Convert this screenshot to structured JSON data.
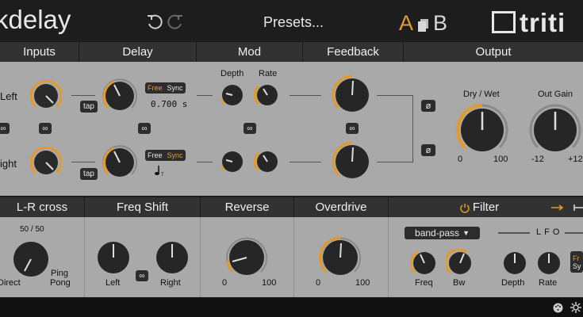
{
  "header": {
    "title": "kdelay",
    "presets_label": "Presets...",
    "ab_a": "A",
    "ab_b": "B",
    "brand": "triti",
    "colors": {
      "accent": "#e39a2a",
      "panel": "#a9a9a9",
      "bar": "#323232"
    }
  },
  "sections": {
    "inputs": "Inputs",
    "delay": "Delay",
    "mod": "Mod",
    "feedback": "Feedback",
    "output": "Output",
    "lr_cross": "L-R cross",
    "freq_shift": "Freq Shift",
    "reverse": "Reverse",
    "overdrive": "Overdrive",
    "filter": "Filter"
  },
  "inputs": {
    "left_label": "Left",
    "right_label": "ight"
  },
  "delay": {
    "tap_label": "tap",
    "free_label": "Free",
    "sync_label": "Sync",
    "time_value": "0.700 s",
    "top_mode": "Free",
    "bottom_mode": "Sync"
  },
  "mod": {
    "depth_label": "Depth",
    "rate_label": "Rate"
  },
  "feedback": {
    "invert_symbol": "ø"
  },
  "output": {
    "drywet_label": "Dry / Wet",
    "drywet_min": "0",
    "drywet_max": "100",
    "outgain_label": "Out Gain",
    "outgain_min": "-12",
    "outgain_max": "+12"
  },
  "lr_cross": {
    "value": "50 / 50",
    "left_label": "Direct",
    "right_label1": "Ping",
    "right_label2": "Pong"
  },
  "freq_shift": {
    "left_label": "Left",
    "right_label": "Right"
  },
  "reverse": {
    "min": "0",
    "max": "100"
  },
  "overdrive": {
    "min": "0",
    "max": "100"
  },
  "filter": {
    "type_value": "band-pass",
    "lfo_label": "LFO",
    "freq_label": "Freq",
    "bw_label": "Bw",
    "depth_label": "Depth",
    "rate_label": "Rate",
    "lfo_free": "Fr",
    "lfo_sync": "Sy"
  }
}
